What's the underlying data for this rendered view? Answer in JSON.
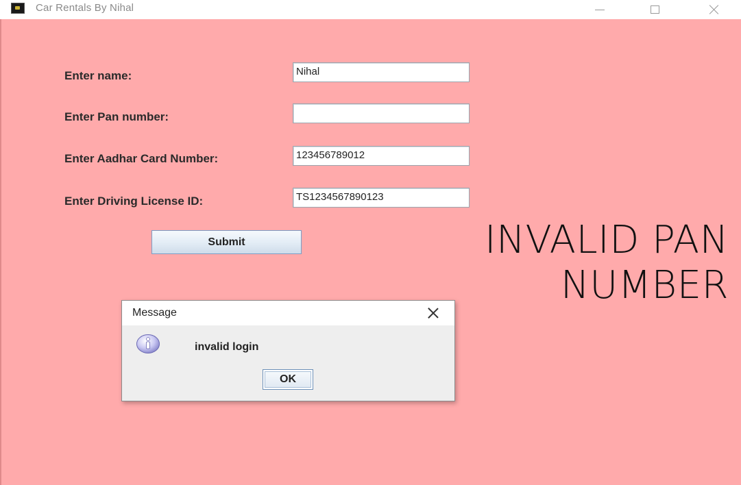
{
  "window": {
    "title": "Car Rentals By Nihal",
    "background_color": "#ffaaab"
  },
  "form": {
    "name_label": "Enter name:",
    "name_value": "Nihal",
    "pan_label": "Enter Pan number:",
    "pan_value": "",
    "aadhar_label": "Enter Aadhar Card Number:",
    "aadhar_value": "123456789012",
    "license_label": "Enter Driving License ID:",
    "license_value": "TS1234567890123",
    "submit_label": "Submit"
  },
  "overlay": {
    "line1": "INVALID PAN",
    "line2": "NUMBER"
  },
  "dialog": {
    "title": "Message",
    "message": "invalid login",
    "ok_label": "OK",
    "icon": "info-icon"
  }
}
